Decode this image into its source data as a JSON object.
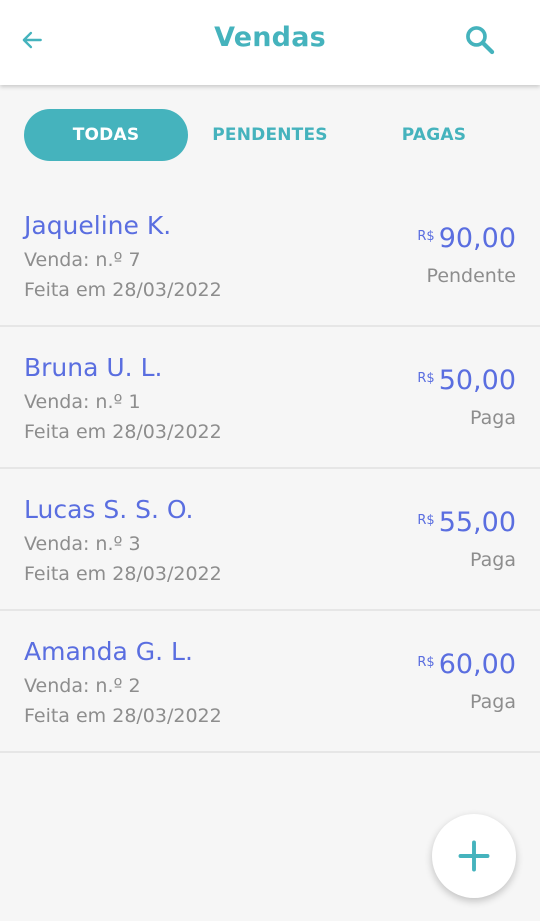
{
  "header": {
    "title": "Vendas",
    "back_icon": "arrow-left-icon",
    "search_icon": "search-icon",
    "accent_color": "#45b3bd"
  },
  "tabs": [
    {
      "label": "TODAS",
      "active": true
    },
    {
      "label": "PENDENTES",
      "active": false
    },
    {
      "label": "PAGAS",
      "active": false
    }
  ],
  "sales": [
    {
      "name": "Jaqueline K.",
      "order": "Venda: n.º 7",
      "date": "Feita em 28/03/2022",
      "currency": "R$",
      "amount": "90,00",
      "status": "Pendente"
    },
    {
      "name": "Bruna U. L.",
      "order": "Venda: n.º 1",
      "date": "Feita em 28/03/2022",
      "currency": "R$",
      "amount": "50,00",
      "status": "Paga"
    },
    {
      "name": "Lucas S. S. O.",
      "order": "Venda: n.º 3",
      "date": "Feita em 28/03/2022",
      "currency": "R$",
      "amount": "55,00",
      "status": "Paga"
    },
    {
      "name": "Amanda G. L.",
      "order": "Venda: n.º 2",
      "date": "Feita em 28/03/2022",
      "currency": "R$",
      "amount": "60,00",
      "status": "Paga"
    }
  ],
  "fab": {
    "icon": "plus-icon"
  },
  "colors": {
    "name": "#5a6ee0",
    "muted": "#8d8d8d",
    "background": "#f6f6f6"
  }
}
